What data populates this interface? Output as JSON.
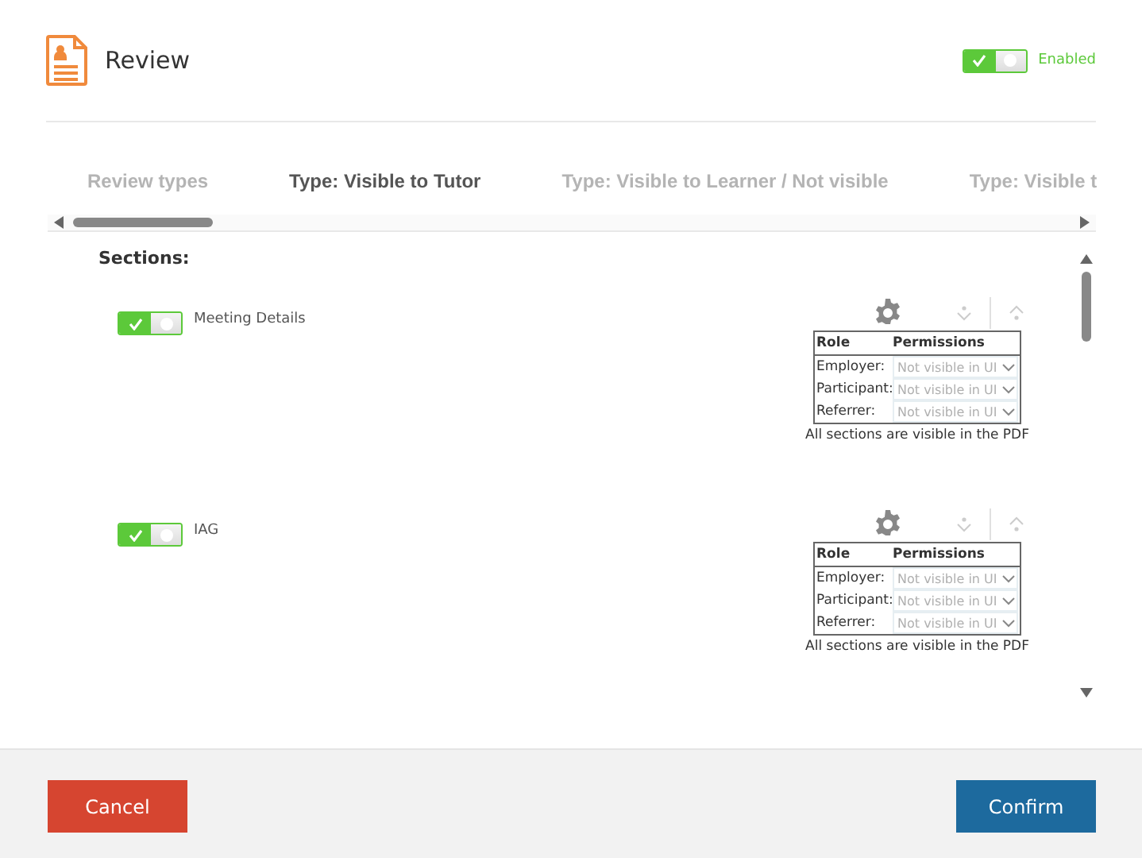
{
  "header": {
    "title": "Review",
    "toggle": {
      "on": true,
      "label": "Enabled"
    }
  },
  "tabs": [
    {
      "label": "Review types",
      "selected": false
    },
    {
      "label": "Type: Visible to Tutor",
      "selected": true
    },
    {
      "label": "Type: Visible to Learner / Not visible",
      "selected": false
    },
    {
      "label": "Type: Visible t",
      "selected": false
    }
  ],
  "sections_label": "Sections:",
  "sections": [
    {
      "name": "Meeting Details",
      "on": true,
      "columns": [
        "Role",
        "Permissions"
      ],
      "roles": [
        {
          "role": "Employer:",
          "permission": "Not visible in UI",
          "disabled": true
        },
        {
          "role": "Participant:",
          "permission": "Not visible in UI",
          "disabled": true
        },
        {
          "role": "Referrer:",
          "permission": "Not visible in UI",
          "disabled": true
        }
      ],
      "note": "All sections are visible in the PDF"
    },
    {
      "name": "IAG",
      "on": true,
      "columns": [
        "Role",
        "Permissions"
      ],
      "roles": [
        {
          "role": "Employer:",
          "permission": "Not visible in UI",
          "disabled": true
        },
        {
          "role": "Participant:",
          "permission": "Not visible in UI",
          "disabled": true
        },
        {
          "role": "Referrer:",
          "permission": "Not visible in UI",
          "disabled": true
        }
      ],
      "note": "All sections are visible in the PDF"
    }
  ],
  "buttons": {
    "cancel": "Cancel",
    "confirm": "Confirm"
  }
}
